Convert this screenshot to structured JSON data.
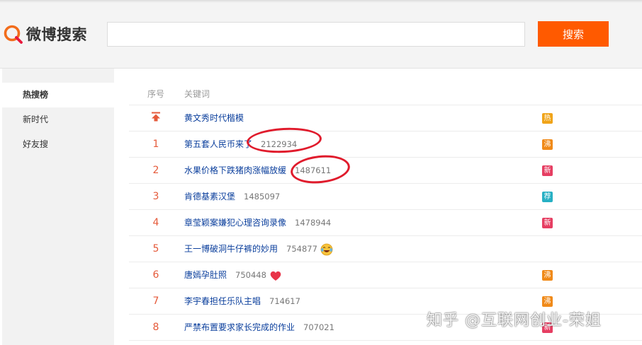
{
  "header": {
    "logo_text": "微博搜索",
    "search_placeholder": "",
    "search_button": "搜索"
  },
  "sidebar": {
    "items": [
      {
        "label": "热搜榜",
        "active": true
      },
      {
        "label": "新时代",
        "active": false
      },
      {
        "label": "好友搜",
        "active": false
      }
    ]
  },
  "table": {
    "headers": {
      "rank": "序号",
      "keyword": "关键词"
    },
    "rows": [
      {
        "rank": "",
        "pinned": true,
        "keyword": "黄文秀时代楷模",
        "count": "",
        "emoji": "",
        "badge": "热",
        "badge_color": "#f0a419"
      },
      {
        "rank": "1",
        "pinned": false,
        "keyword": "第五套人民币来了",
        "count": "2122934",
        "emoji": "",
        "badge": "沸",
        "badge_color": "#f08a19"
      },
      {
        "rank": "2",
        "pinned": false,
        "keyword": "水果价格下跌猪肉涨幅放缓",
        "count": "1487611",
        "emoji": "",
        "badge": "新",
        "badge_color": "#e63e62"
      },
      {
        "rank": "3",
        "pinned": false,
        "keyword": "肯德基素汉堡",
        "count": "1485097",
        "emoji": "",
        "badge": "荐",
        "badge_color": "#27b0c4"
      },
      {
        "rank": "4",
        "pinned": false,
        "keyword": "章莹颖案嫌犯心理咨询录像",
        "count": "1478944",
        "emoji": "",
        "badge": "新",
        "badge_color": "#e63e62"
      },
      {
        "rank": "5",
        "pinned": false,
        "keyword": "王一博破洞牛仔裤的妙用",
        "count": "754877",
        "emoji": "laugh-cry-emoji",
        "badge": "",
        "badge_color": ""
      },
      {
        "rank": "6",
        "pinned": false,
        "keyword": "唐嫣孕肚照",
        "count": "750448",
        "emoji": "heart-emoji",
        "badge": "沸",
        "badge_color": "#f08a19"
      },
      {
        "rank": "7",
        "pinned": false,
        "keyword": "李宇春担任乐队主唱",
        "count": "714617",
        "emoji": "",
        "badge": "沸",
        "badge_color": "#f08a19"
      },
      {
        "rank": "8",
        "pinned": false,
        "keyword": "严禁布置要求家长完成的作业",
        "count": "707021",
        "emoji": "",
        "badge": "新",
        "badge_color": "#e63e62"
      }
    ]
  },
  "watermark": "知乎 @互联网创业-荣姐",
  "colors": {
    "accent": "#ff5a00",
    "link": "#0a3e9c",
    "rank": "#e55a3a",
    "annotation": "#e01b2c"
  }
}
